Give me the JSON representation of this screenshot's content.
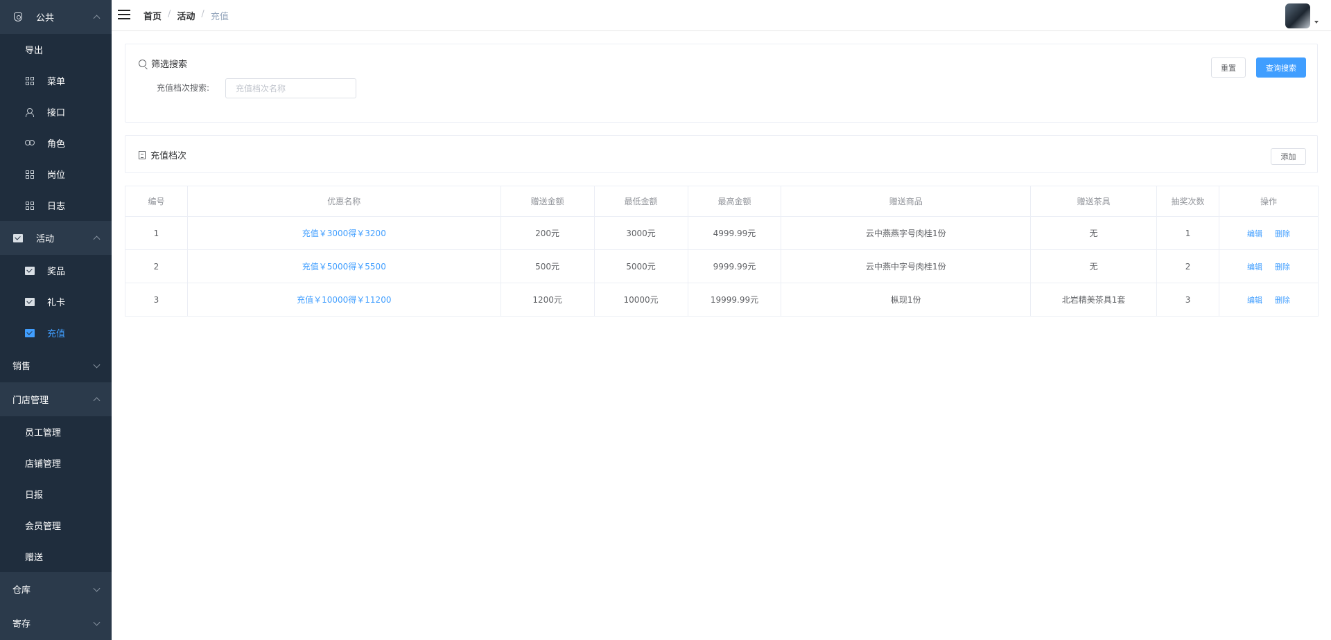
{
  "sidebar": {
    "groups": [
      {
        "label": "公共",
        "icon": "shield-icon",
        "expanded": true,
        "items": [
          {
            "label": "导出",
            "icon": ""
          },
          {
            "label": "菜单",
            "icon": "grid-icon"
          },
          {
            "label": "接口",
            "icon": "user-icon"
          },
          {
            "label": "角色",
            "icon": "users-icon"
          },
          {
            "label": "岗位",
            "icon": "grid-icon"
          },
          {
            "label": "日志",
            "icon": "grid-icon"
          }
        ]
      },
      {
        "label": "活动",
        "icon": "box-icon",
        "expanded": true,
        "items": [
          {
            "label": "奖品",
            "icon": "box-icon"
          },
          {
            "label": "礼卡",
            "icon": "box-icon"
          },
          {
            "label": "充值",
            "icon": "box-icon",
            "active": true
          }
        ]
      },
      {
        "label": "销售",
        "expanded": false
      },
      {
        "label": "门店管理",
        "expanded": true,
        "items": [
          {
            "label": "员工管理"
          },
          {
            "label": "店铺管理"
          },
          {
            "label": "日报"
          },
          {
            "label": "会员管理"
          },
          {
            "label": "赠送"
          }
        ]
      },
      {
        "label": "仓库",
        "expanded": false
      },
      {
        "label": "寄存",
        "expanded": false
      }
    ]
  },
  "header": {
    "breadcrumb": [
      "首页",
      "活动",
      "充值"
    ]
  },
  "filter": {
    "title": "筛选搜索",
    "label": "充值档次搜索:",
    "placeholder": "充值档次名称",
    "value": "",
    "reset_label": "重置",
    "search_label": "查询搜索"
  },
  "list": {
    "title": "充值档次",
    "add_label": "添加"
  },
  "table": {
    "columns": [
      "编号",
      "优惠名称",
      "赠送金额",
      "最低金额",
      "最高金额",
      "赠送商品",
      "赠送茶具",
      "抽奖次数",
      "操作"
    ],
    "rows": [
      {
        "id": "1",
        "name": "充值￥3000得￥3200",
        "gift_amount": "200元",
        "min": "3000元",
        "max": "4999.99元",
        "goods": "云中燕燕字号肉桂1份",
        "tea_set": "无",
        "draws": "1",
        "edit": "编辑",
        "delete": "删除"
      },
      {
        "id": "2",
        "name": "充值￥5000得￥5500",
        "gift_amount": "500元",
        "min": "5000元",
        "max": "9999.99元",
        "goods": "云中燕中字号肉桂1份",
        "tea_set": "无",
        "draws": "2",
        "edit": "编辑",
        "delete": "删除"
      },
      {
        "id": "3",
        "name": "充值￥10000得￥11200",
        "gift_amount": "1200元",
        "min": "10000元",
        "max": "19999.99元",
        "goods": "枞现1份",
        "tea_set": "北岩精美茶具1套",
        "draws": "3",
        "edit": "编辑",
        "delete": "删除"
      }
    ]
  },
  "colors": {
    "sidebar_bg": "#1f2d3d",
    "accent": "#409eff"
  }
}
